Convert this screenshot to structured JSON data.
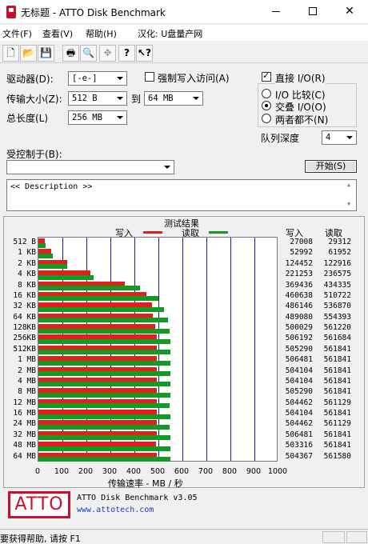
{
  "window": {
    "title": "无标题 - ATTO Disk Benchmark",
    "minimize": "—",
    "maximize": "□",
    "close": "✕"
  },
  "menu": [
    "文件(F)",
    "查看(V)",
    "帮助(H)",
    "汉化: U盘量产网"
  ],
  "toolbar_icons": [
    "new-icon",
    "open-icon",
    "save-icon",
    "print-icon",
    "print-preview-icon",
    "move-icon",
    "help-icon",
    "context-help-icon"
  ],
  "form": {
    "drive_label": "驱动器(D):",
    "drive_value": "[-e-]",
    "force_write_label": "强制写入访问(A)",
    "transfer_label": "传输大小(Z):",
    "transfer_from": "512 B",
    "to_label": "到",
    "transfer_to": "64 MB",
    "total_label": "总长度(L)",
    "total_value": "256 MB",
    "direct_io_label": "直接 I/O(R)",
    "io_compare_label": "I/O 比较(C)",
    "overlap_label": "交叠 I/O(O)",
    "neither_label": "两者都不(N)",
    "queue_label": "队列深度",
    "queue_value": "4",
    "controlled_label": "受控制于(B):",
    "controlled_value": "",
    "start_button": "开始(S)",
    "description": "<< Description >>"
  },
  "results": {
    "title": "测试结果",
    "legend_write": "写入",
    "legend_read": "读取",
    "col_write": "写入",
    "col_read": "读取",
    "x_axis_title": "传输速率 - MB / 秒",
    "x_ticks": [
      "0",
      "100",
      "200",
      "300",
      "400",
      "500",
      "600",
      "700",
      "800",
      "900",
      "1000"
    ]
  },
  "chart_data": {
    "type": "bar",
    "orientation": "horizontal",
    "xlim": [
      0,
      1000
    ],
    "categories": [
      "512 B",
      "1 KB",
      "2 KB",
      "4 KB",
      "8 KB",
      "16 KB",
      "32 KB",
      "64 KB",
      "128KB",
      "256KB",
      "512KB",
      "1 MB",
      "2 MB",
      "4 MB",
      "8 MB",
      "12 MB",
      "16 MB",
      "24 MB",
      "32 MB",
      "48 MB",
      "64 MB"
    ],
    "series": [
      {
        "name": "写入",
        "color": "#e0201c",
        "values": [
          27008,
          52992,
          124452,
          221253,
          369436,
          460638,
          486146,
          489080,
          500029,
          506192,
          505290,
          506481,
          504104,
          504104,
          505290,
          504462,
          504104,
          504462,
          506481,
          503316,
          504367
        ]
      },
      {
        "name": "读取",
        "color": "#139a22",
        "values": [
          29312,
          61952,
          122916,
          236575,
          434335,
          510722,
          536870,
          554393,
          561220,
          561684,
          561841,
          561841,
          561841,
          561841,
          561841,
          561129,
          561841,
          561129,
          561841,
          561841,
          561580
        ]
      }
    ],
    "value_unit_note": "KB/s"
  },
  "footer": {
    "logo": "ATTO",
    "version": "ATTO Disk Benchmark v3.05",
    "url": "www.attotech.com",
    "status": "要获得帮助, 请按 F1"
  },
  "colors": {
    "write": "#e0201c",
    "read": "#139a22",
    "brand": "#c8102e",
    "grid": "#1f1f8f"
  }
}
